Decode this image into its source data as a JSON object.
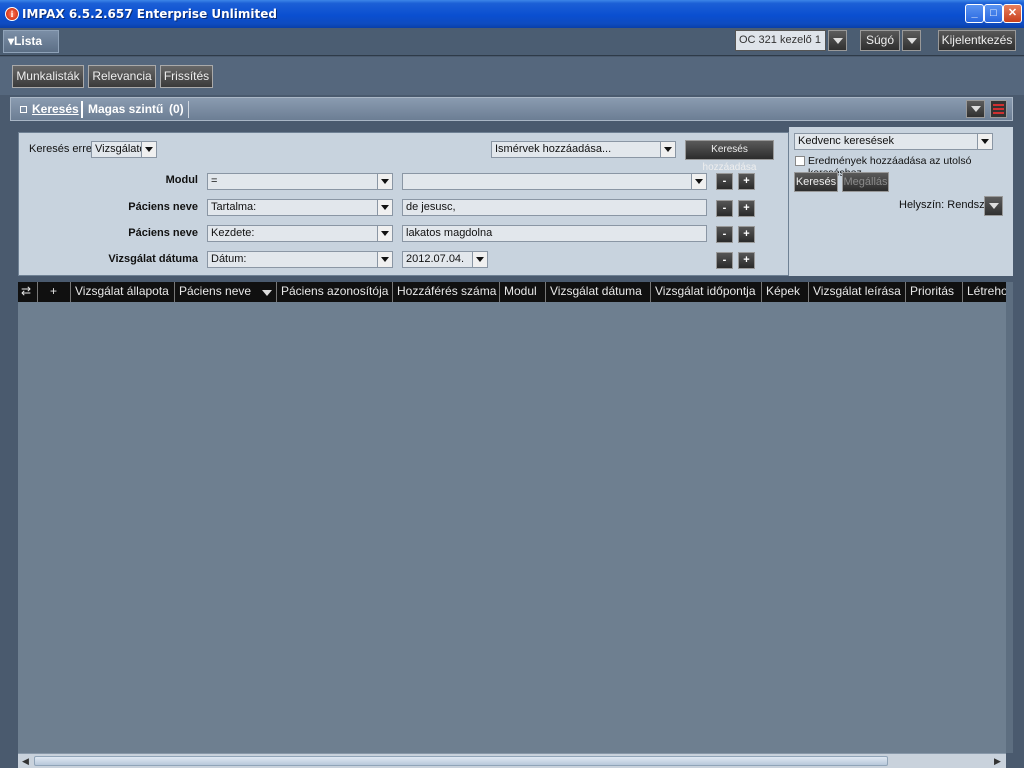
{
  "window": {
    "title": "IMPAX 6.5.2.657 Enterprise Unlimited"
  },
  "menubar": {
    "lista_label": "Lista",
    "user": "OC 321 kezelő 1",
    "help": "Súgó",
    "logout": "Kijelentkezés"
  },
  "toolbar": {
    "worklists": "Munkalisták",
    "relevance": "Relevancia",
    "refresh": "Frissítés"
  },
  "search_header": {
    "tab_search": "Keresés",
    "tab_advanced": "Magas szintű",
    "count": "(0)"
  },
  "search": {
    "search_for_label": "Keresés erre:",
    "search_for_value": "Vizsgálatok",
    "criteria_combo": "Ismérvek hozzáadása...",
    "add_search_button": "Keresés hozzáadása",
    "rows": [
      {
        "label": "Modul",
        "operator": "=",
        "value": ""
      },
      {
        "label": "Páciens neve",
        "operator": "Tartalma:",
        "value": "de jesusc,"
      },
      {
        "label": "Páciens neve",
        "operator": "Kezdete:",
        "value": "lakatos magdolna"
      },
      {
        "label": "Vizsgálat dátuma",
        "operator": "Dátum:",
        "value": "2012.07.04."
      }
    ],
    "minus": "-",
    "plus": "+"
  },
  "favorites": {
    "combo": "Kedvenc keresések",
    "append_label": "Eredmények hozzáadása az utolsó kereséshez",
    "search_button": "Keresés",
    "stop_button": "Megállás",
    "location": "Helyszín: Rendszer"
  },
  "table": {
    "headers": [
      "+",
      "Vizsgálat állapota",
      "Páciens neve",
      "Páciens azonosítója",
      "Hozzáférés száma",
      "Modul",
      "Vizsgálat dátuma",
      "Vizsgálat időpontja",
      "Képek",
      "Vizsgálat leírása",
      "Prioritás",
      "Létreho"
    ]
  }
}
